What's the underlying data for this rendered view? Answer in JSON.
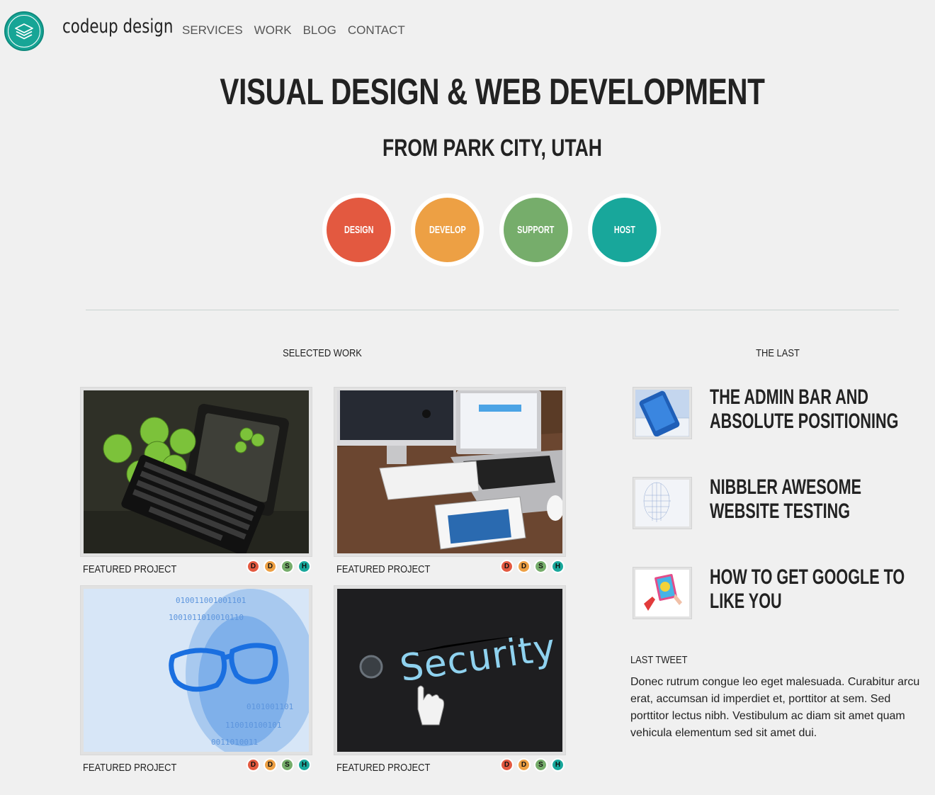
{
  "header": {
    "brand": "codeup design",
    "nav": [
      "SERVICES",
      "WORK",
      "BLOG",
      "CONTACT"
    ]
  },
  "hero": {
    "title": "VISUAL DESIGN & WEB DEVELOPMENT",
    "subtitle": "FROM PARK CITY, UTAH"
  },
  "services": [
    {
      "label": "DESIGN",
      "color": "#e35940"
    },
    {
      "label": "DEVELOP",
      "color": "#eda044"
    },
    {
      "label": "SUPPORT",
      "color": "#76ad6b"
    },
    {
      "label": "HOST",
      "color": "#18a79b"
    }
  ],
  "work": {
    "label": "SELECTED WORK",
    "projects": [
      {
        "caption": "FEATURED PROJECT",
        "badges": [
          "D",
          "D",
          "S",
          "H"
        ]
      },
      {
        "caption": "FEATURED PROJECT",
        "badges": [
          "D",
          "D",
          "S",
          "H"
        ]
      },
      {
        "caption": "FEATURED PROJECT",
        "badges": [
          "D",
          "D",
          "S",
          "H"
        ]
      },
      {
        "caption": "FEATURED PROJECT",
        "badges": [
          "D",
          "D",
          "S",
          "H"
        ]
      }
    ]
  },
  "last": {
    "label": "THE LAST",
    "posts": [
      {
        "title": "THE ADMIN BAR AND ABSOLUTE POSITIONING"
      },
      {
        "title": "NIBBLER AWESOME WEBSITE TESTING"
      },
      {
        "title": "HOW TO GET GOOGLE TO LIKE YOU"
      }
    ]
  },
  "tweet": {
    "label": "LAST TWEET",
    "text": "Donec rutrum congue leo eget malesuada. Curabitur arcu erat, accumsan id imperdiet et, porttitor at sem. Sed porttitor lectus nibh. Vestibulum ac diam sit amet quam vehicula elementum sed sit amet dui."
  },
  "badge_colors": [
    "#e35940",
    "#eda044",
    "#76ad6b",
    "#18a79b"
  ]
}
